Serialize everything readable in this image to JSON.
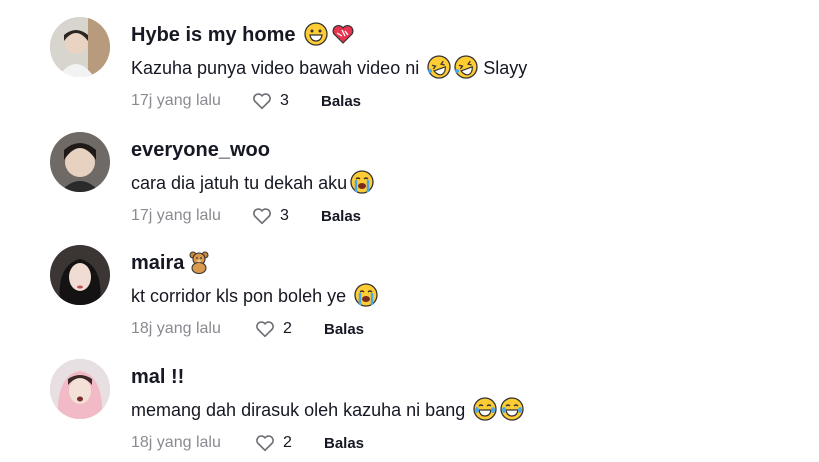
{
  "comments": [
    {
      "username": "Hybe is my home",
      "username_emojis": [
        "grinning-face-icon",
        "mending-heart-icon"
      ],
      "text": "Kazuha punya video bawah video ni",
      "text_emojis": [
        "rolling-laughing-icon",
        "rolling-laughing-icon"
      ],
      "text_suffix": "Slayy",
      "time": "17j yang lalu",
      "likes": "3",
      "reply": "Balas"
    },
    {
      "username": "everyone_woo",
      "username_emojis": [],
      "text": "cara dia jatuh tu dekah aku",
      "text_emojis": [
        "loudly-crying-icon"
      ],
      "text_suffix": "",
      "time": "17j yang lalu",
      "likes": "3",
      "reply": "Balas"
    },
    {
      "username": "maira",
      "username_emojis": [
        "teddy-bear-icon"
      ],
      "text": "kt corridor kls pon boleh ye",
      "text_emojis": [
        "loudly-crying-icon"
      ],
      "text_suffix": "",
      "time": "18j yang lalu",
      "likes": "2",
      "reply": "Balas"
    },
    {
      "username": "mal !!",
      "username_emojis": [],
      "text": "memang dah dirasuk oleh kazuha ni bang",
      "text_emojis": [
        "tears-of-joy-icon",
        "tears-of-joy-icon"
      ],
      "text_suffix": "",
      "time": "18j yang lalu",
      "likes": "2",
      "reply": "Balas"
    }
  ]
}
